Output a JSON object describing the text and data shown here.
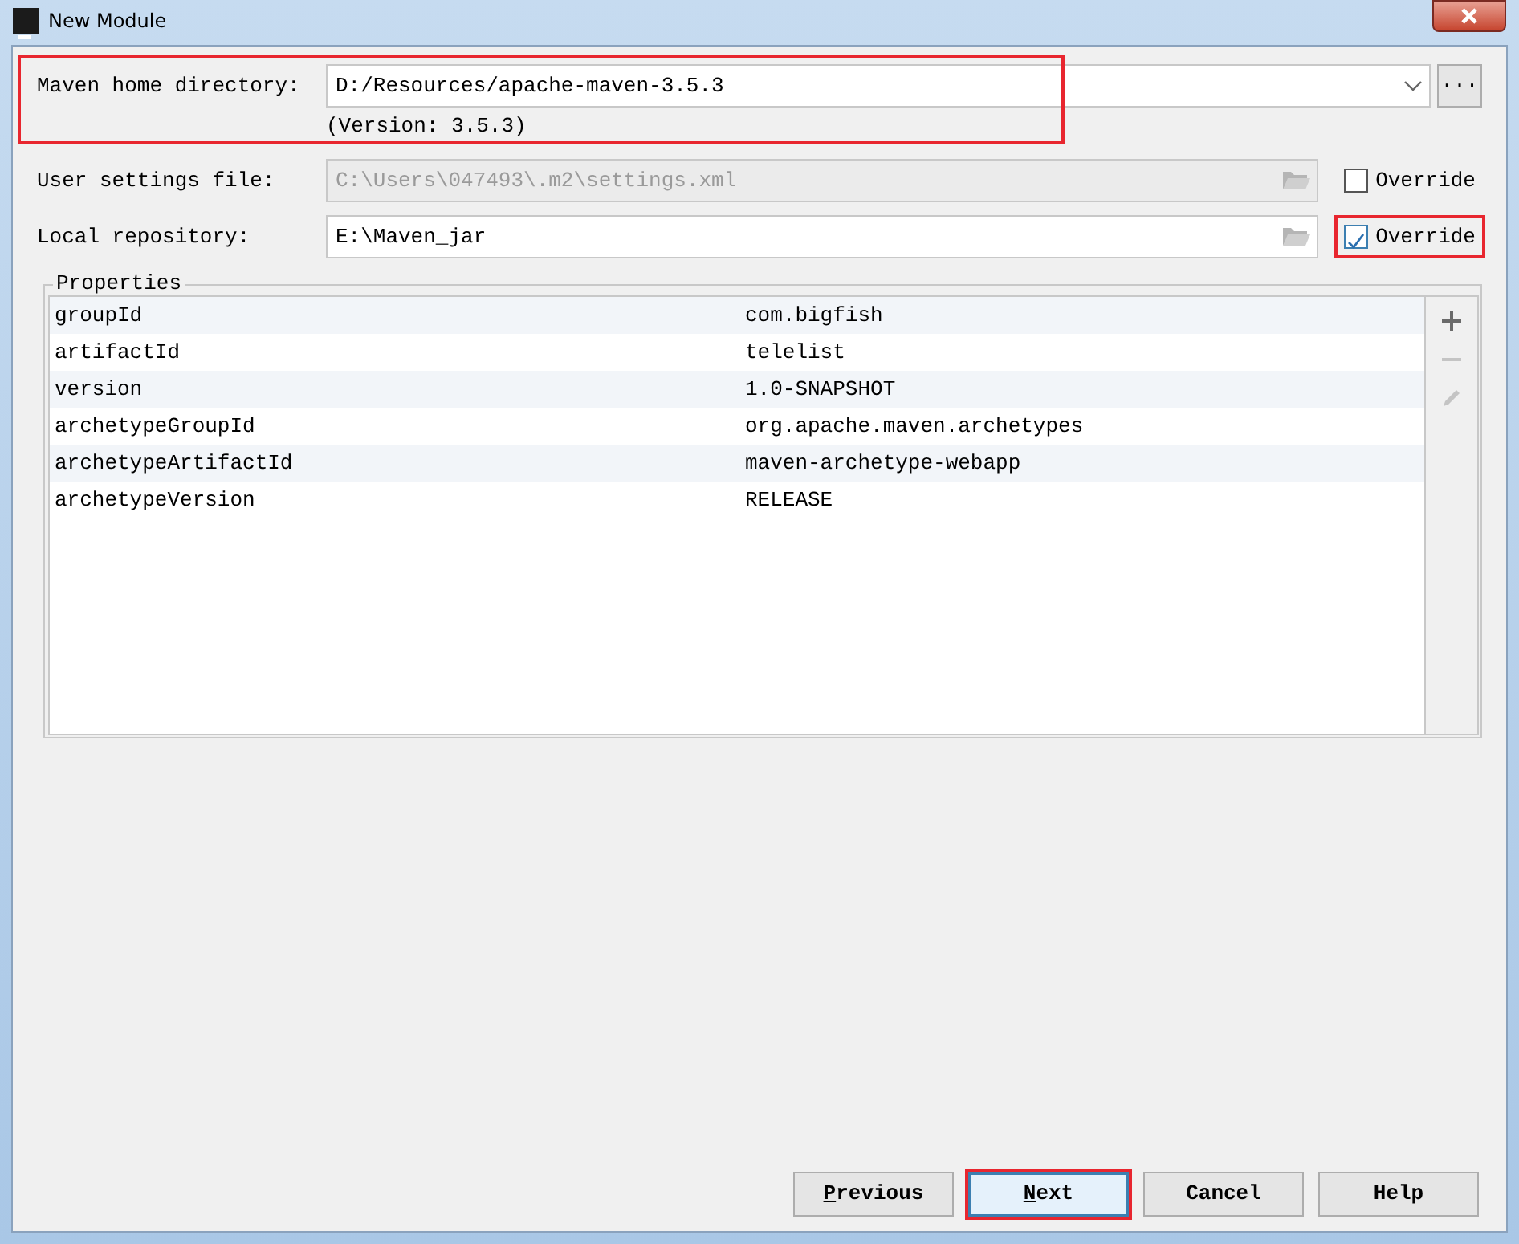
{
  "window": {
    "title": "New Module"
  },
  "maven_home": {
    "label": "Maven home directory:",
    "value": "D:/Resources/apache-maven-3.5.3",
    "version": "(Version: 3.5.3)",
    "browse": "...",
    "highlighted": true
  },
  "user_settings": {
    "label": "User settings file:",
    "value": "C:\\Users\\047493\\.m2\\settings.xml",
    "disabled": true,
    "override": {
      "label": "Override",
      "checked": false,
      "highlighted": false
    }
  },
  "local_repository": {
    "label": "Local repository:",
    "value": "E:\\Maven_jar",
    "disabled": false,
    "override": {
      "label": "Override",
      "checked": true,
      "highlighted": true
    }
  },
  "properties": {
    "title": "Properties",
    "rows": [
      {
        "name": "groupId",
        "value": "com.bigfish"
      },
      {
        "name": "artifactId",
        "value": "telelist"
      },
      {
        "name": "version",
        "value": "1.0-SNAPSHOT"
      },
      {
        "name": "archetypeGroupId",
        "value": "org.apache.maven.archetypes"
      },
      {
        "name": "archetypeArtifactId",
        "value": "maven-archetype-webapp"
      },
      {
        "name": "archetypeVersion",
        "value": "RELEASE"
      }
    ],
    "tools": [
      {
        "kind": "add",
        "disabled": false
      },
      {
        "kind": "remove",
        "disabled": true
      },
      {
        "kind": "edit",
        "disabled": true
      }
    ]
  },
  "buttons": [
    {
      "label": "Previous",
      "mnemonic": true,
      "default": false,
      "highlighted": false
    },
    {
      "label": "Next",
      "mnemonic": true,
      "default": true,
      "highlighted": true
    },
    {
      "label": "Cancel",
      "mnemonic": false,
      "default": false,
      "highlighted": false
    },
    {
      "label": "Help",
      "mnemonic": false,
      "default": false,
      "highlighted": false
    }
  ]
}
